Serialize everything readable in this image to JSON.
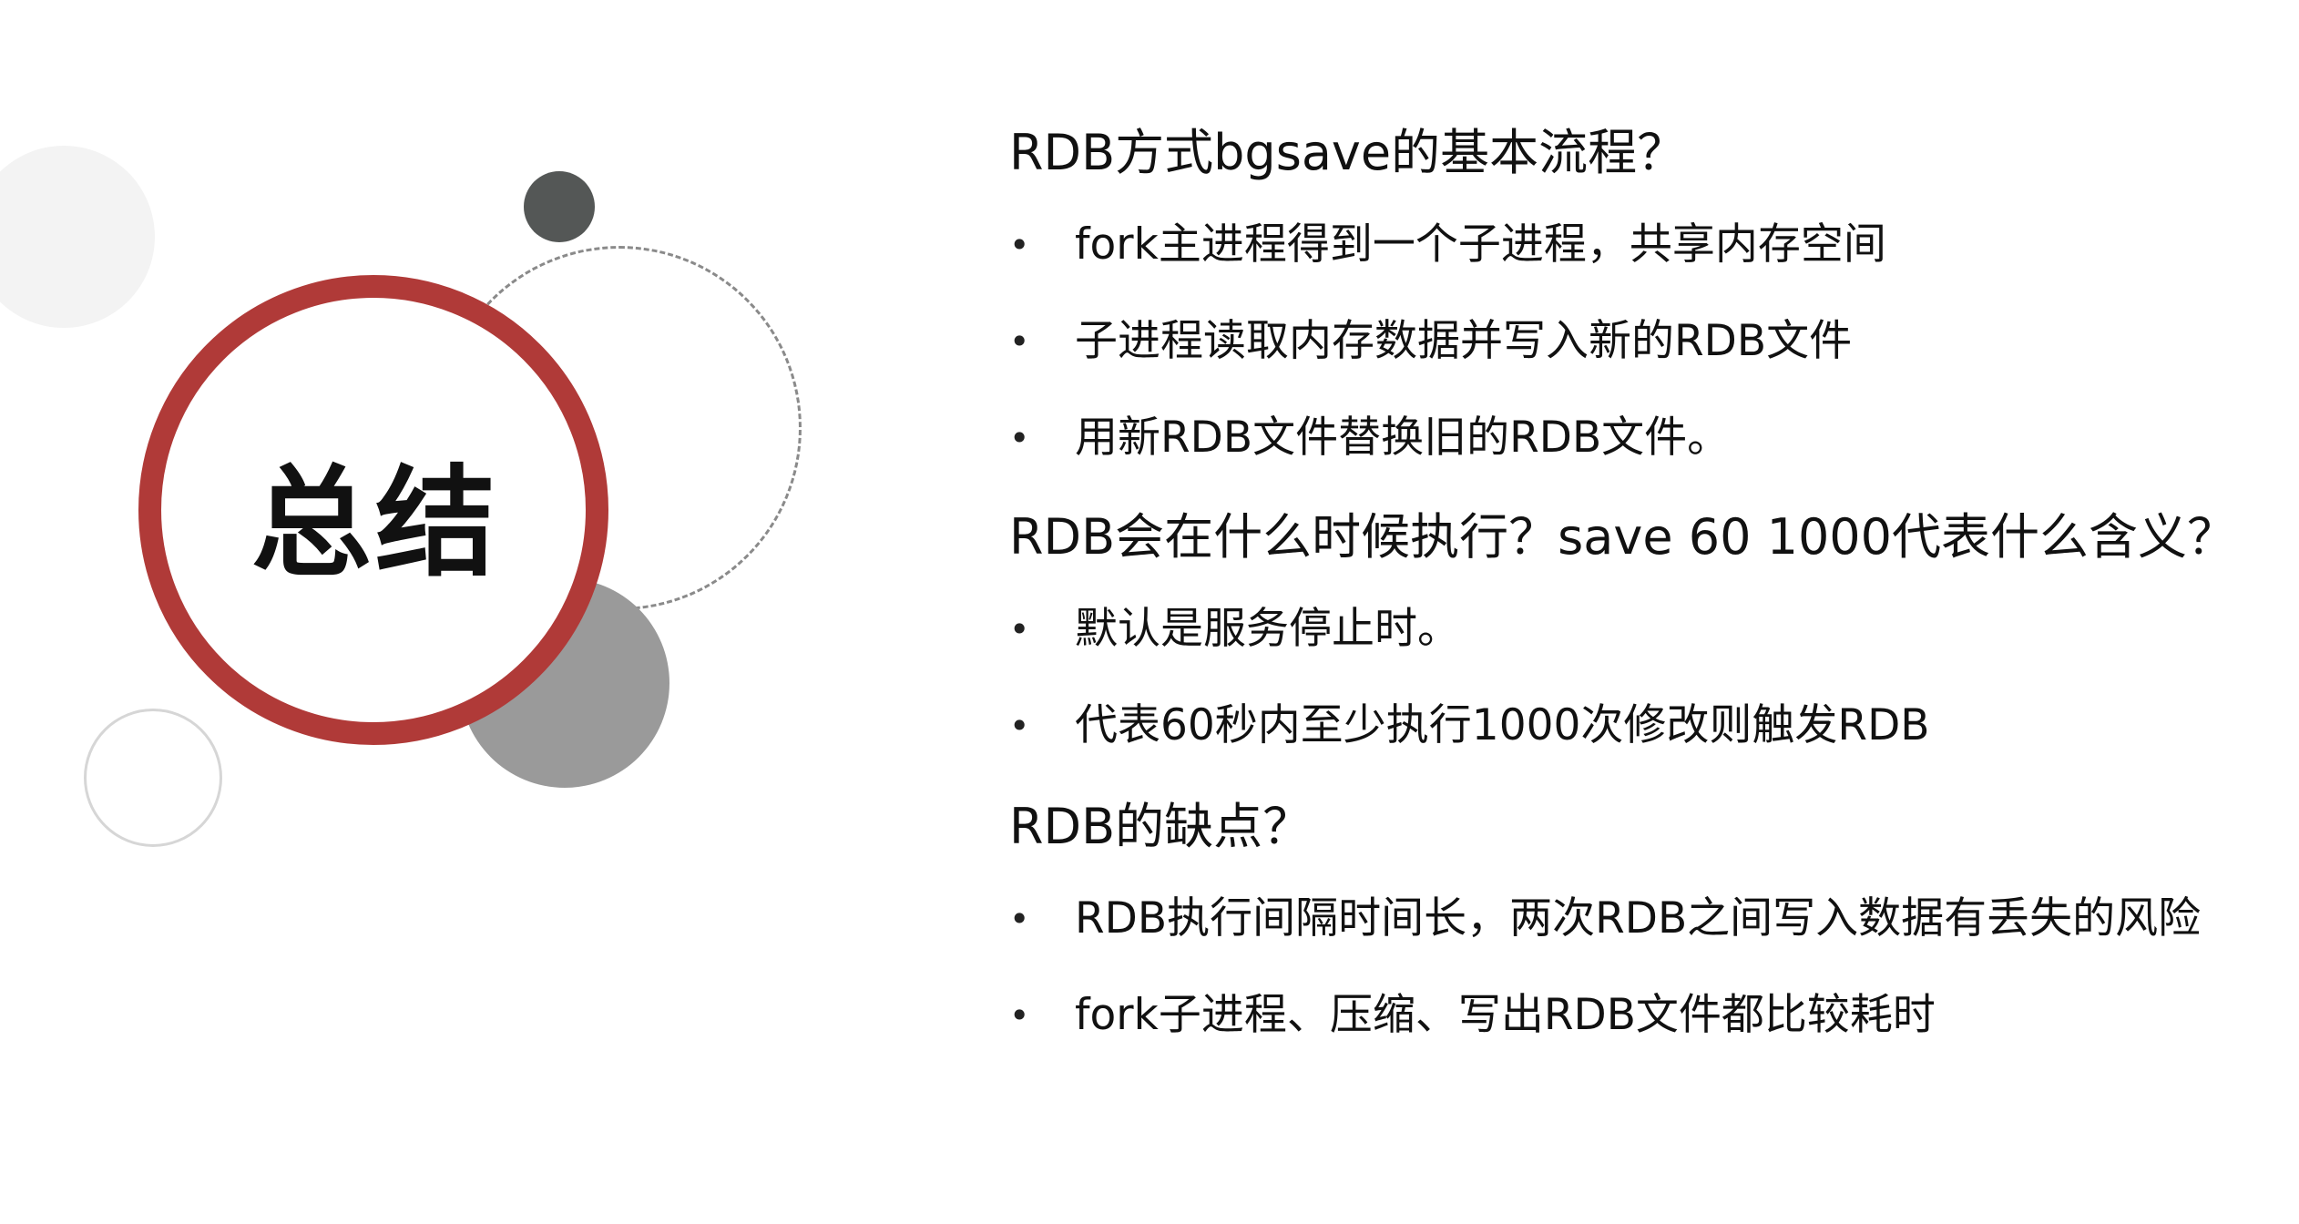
{
  "slide": {
    "title": "总结",
    "accent_color": "#b03a38",
    "sections": [
      {
        "heading": "RDB方式bgsave的基本流程？",
        "bullets": [
          "fork主进程得到一个子进程，共享内存空间",
          "子进程读取内存数据并写入新的RDB文件",
          "用新RDB文件替换旧的RDB文件。"
        ]
      },
      {
        "heading": "RDB会在什么时候执行？save 60 1000代表什么含义？",
        "bullets": [
          "默认是服务停止时。",
          "代表60秒内至少执行1000次修改则触发RDB"
        ]
      },
      {
        "heading": "RDB的缺点？",
        "bullets": [
          "RDB执行间隔时间长，两次RDB之间写入数据有丢失的风险",
          "fork子进程、压缩、写出RDB文件都比较耗时"
        ]
      }
    ]
  }
}
